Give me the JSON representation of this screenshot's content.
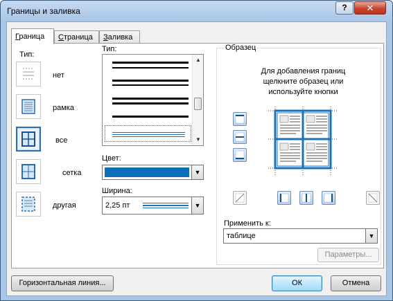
{
  "window": {
    "title": "Границы и заливка",
    "help_label": "?",
    "close_label": "✕"
  },
  "tabs": [
    {
      "label": "Граница",
      "mnemonic": "Г",
      "rest": "раница",
      "active": true
    },
    {
      "label": "Страница",
      "mnemonic": "С",
      "rest": "траница",
      "active": false
    },
    {
      "label": "Заливка",
      "mnemonic": "З",
      "rest": "аливка",
      "active": false
    }
  ],
  "setting": {
    "label": "Тип:",
    "items": [
      {
        "name": "нет",
        "selected": false,
        "icon": "border-none-icon"
      },
      {
        "name": "рамка",
        "selected": false,
        "icon": "border-box-icon"
      },
      {
        "name": "все",
        "selected": true,
        "icon": "border-all-icon"
      },
      {
        "name": "сетка",
        "selected": false,
        "icon": "border-grid-icon"
      },
      {
        "name": "другая",
        "selected": false,
        "icon": "border-custom-icon"
      }
    ]
  },
  "style": {
    "label": "Тип:",
    "selected_index": 4
  },
  "color": {
    "label": "Цвет:",
    "value_color": "#0c6eb7"
  },
  "width": {
    "label": "Ширина:",
    "value": "2,25 пт"
  },
  "preview": {
    "label": "Образец",
    "hint": "Для добавления границ щелкните образец или используйте кнопки",
    "border_color": "#1a73b8"
  },
  "apply": {
    "label": "Применить к:",
    "value": "таблице"
  },
  "buttons": {
    "params": "Параметры...",
    "horizontal_line": "Горизонтальная линия...",
    "ok": "ОК",
    "cancel": "Отмена"
  }
}
